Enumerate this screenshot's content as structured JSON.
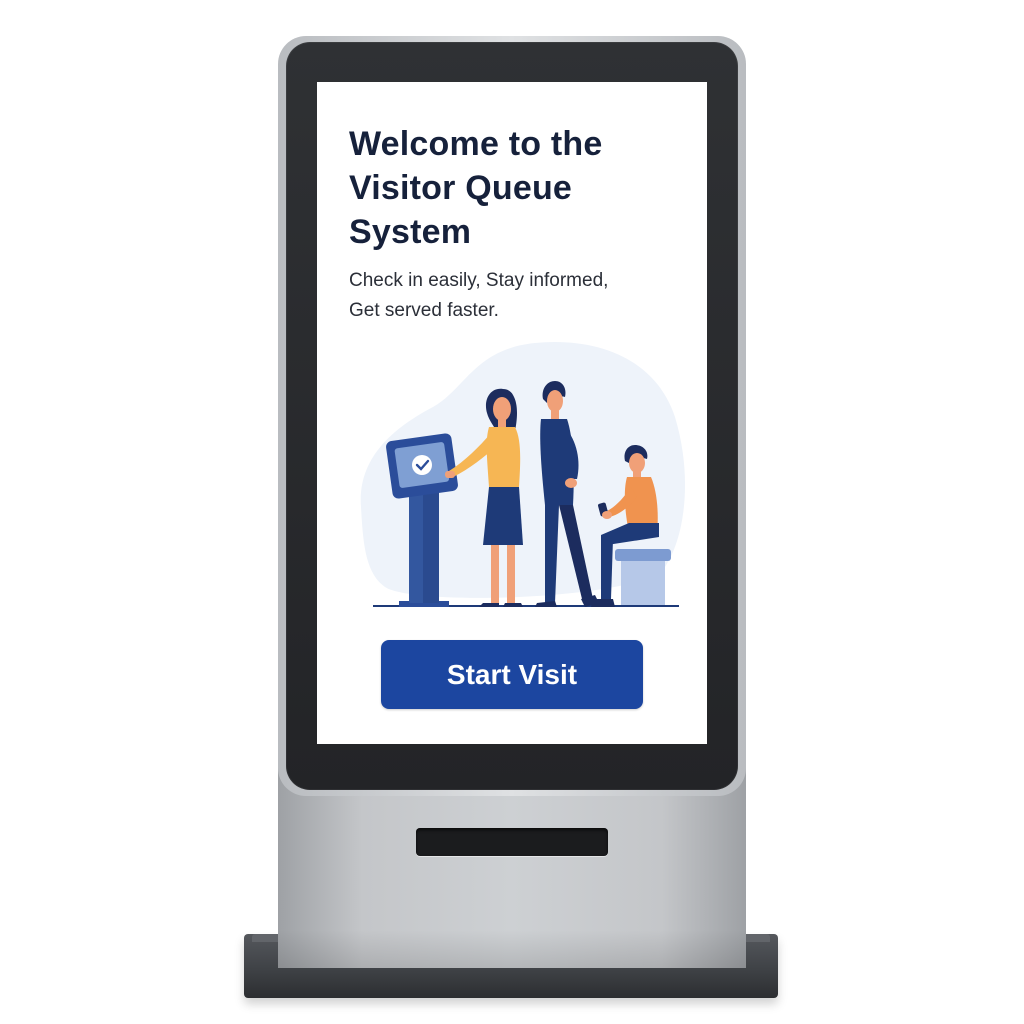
{
  "screen": {
    "title": "Welcome to the Visitor Queue System",
    "subtitle": "Check in easily, Stay informed, Get served faster."
  },
  "actions": {
    "start_label": "Start Visit"
  },
  "icons": {
    "kiosk_screen": "checkmark-icon"
  },
  "colors": {
    "primary": "#1c46a0",
    "heading": "#16213b",
    "bezel": "#232427"
  }
}
